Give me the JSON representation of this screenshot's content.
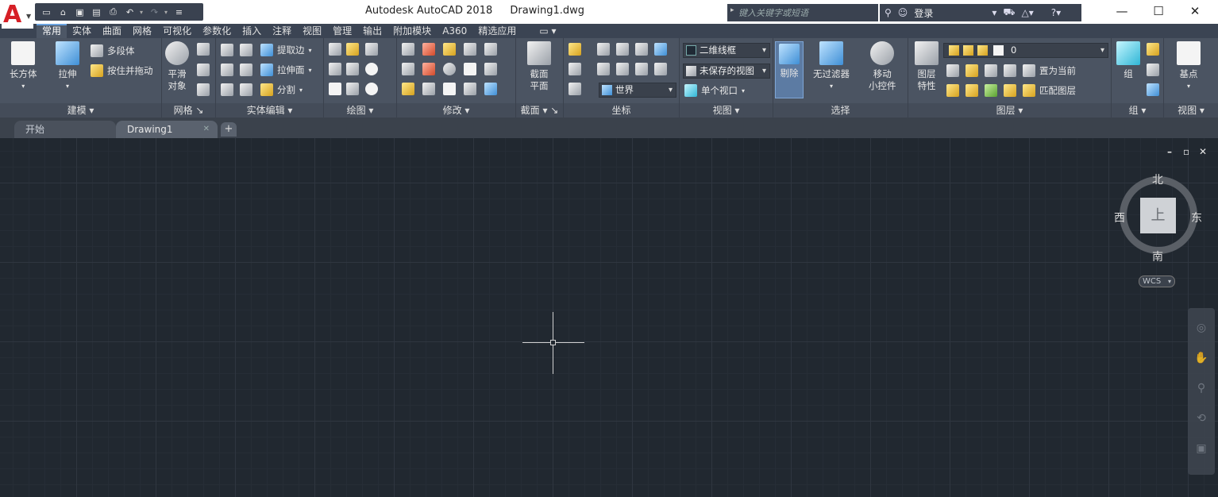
{
  "app": {
    "title": "Autodesk AutoCAD 2018",
    "document": "Drawing1.dwg"
  },
  "search": {
    "placeholder": "键入关键字或短语"
  },
  "account": {
    "login_label": "登录"
  },
  "ribbon_tabs": [
    "常用",
    "实体",
    "曲面",
    "网格",
    "可视化",
    "参数化",
    "插入",
    "注释",
    "视图",
    "管理",
    "输出",
    "附加模块",
    "A360",
    "精选应用"
  ],
  "panels": {
    "modeling": {
      "title": "建模 ▾",
      "box_label": "长方体",
      "extrude_label": "拉伸",
      "polysolid_label": "多段体",
      "presspull_label": "按住并拖动"
    },
    "mesh": {
      "title": "网格 ↘",
      "smooth_label_1": "平滑",
      "smooth_label_2": "对象"
    },
    "solid_edit": {
      "title": "实体编辑 ▾",
      "extract_edges_label": "提取边",
      "extrude_face_label": "拉伸面",
      "separate_label": "分割"
    },
    "draw": {
      "title": "绘图 ▾"
    },
    "modify": {
      "title": "修改 ▾"
    },
    "section": {
      "title": "截面 ▾ ↘",
      "plane_label_1": "截面",
      "plane_label_2": "平面"
    },
    "coordinates": {
      "title": "坐标",
      "ucs_world_label": "世界"
    },
    "view": {
      "title": "视图 ▾",
      "visual_style_value": "二维线框",
      "saved_view_value": "未保存的视图",
      "viewport_value": "单个视口"
    },
    "selection": {
      "title": "选择",
      "culling_label": "剔除",
      "no_filter_label": "无过滤器",
      "gizmo_label_1": "移动",
      "gizmo_label_2": "小控件"
    },
    "layers": {
      "title": "图层 ▾",
      "layer_props_1": "图层",
      "layer_props_2": "特性",
      "current_layer": "0",
      "set_current_label": "置为当前",
      "match_layer_label": "匹配图层"
    },
    "groups": {
      "title": "组 ▾",
      "group_label": "组"
    },
    "view2": {
      "title": "视图 ▾",
      "base_label": "基点"
    }
  },
  "file_tabs": {
    "start_label": "开始",
    "drawing_label": "Drawing1",
    "add_symbol": "+"
  },
  "viewcube": {
    "top_label": "上",
    "north": "北",
    "south": "南",
    "east": "东",
    "west": "西",
    "wcs_label": "WCS"
  },
  "viewport_controls": {
    "minimize": "–",
    "restore": "▫",
    "close": "✕"
  },
  "window_controls": {
    "minimize": "—",
    "maximize": "☐",
    "close": "✕"
  }
}
